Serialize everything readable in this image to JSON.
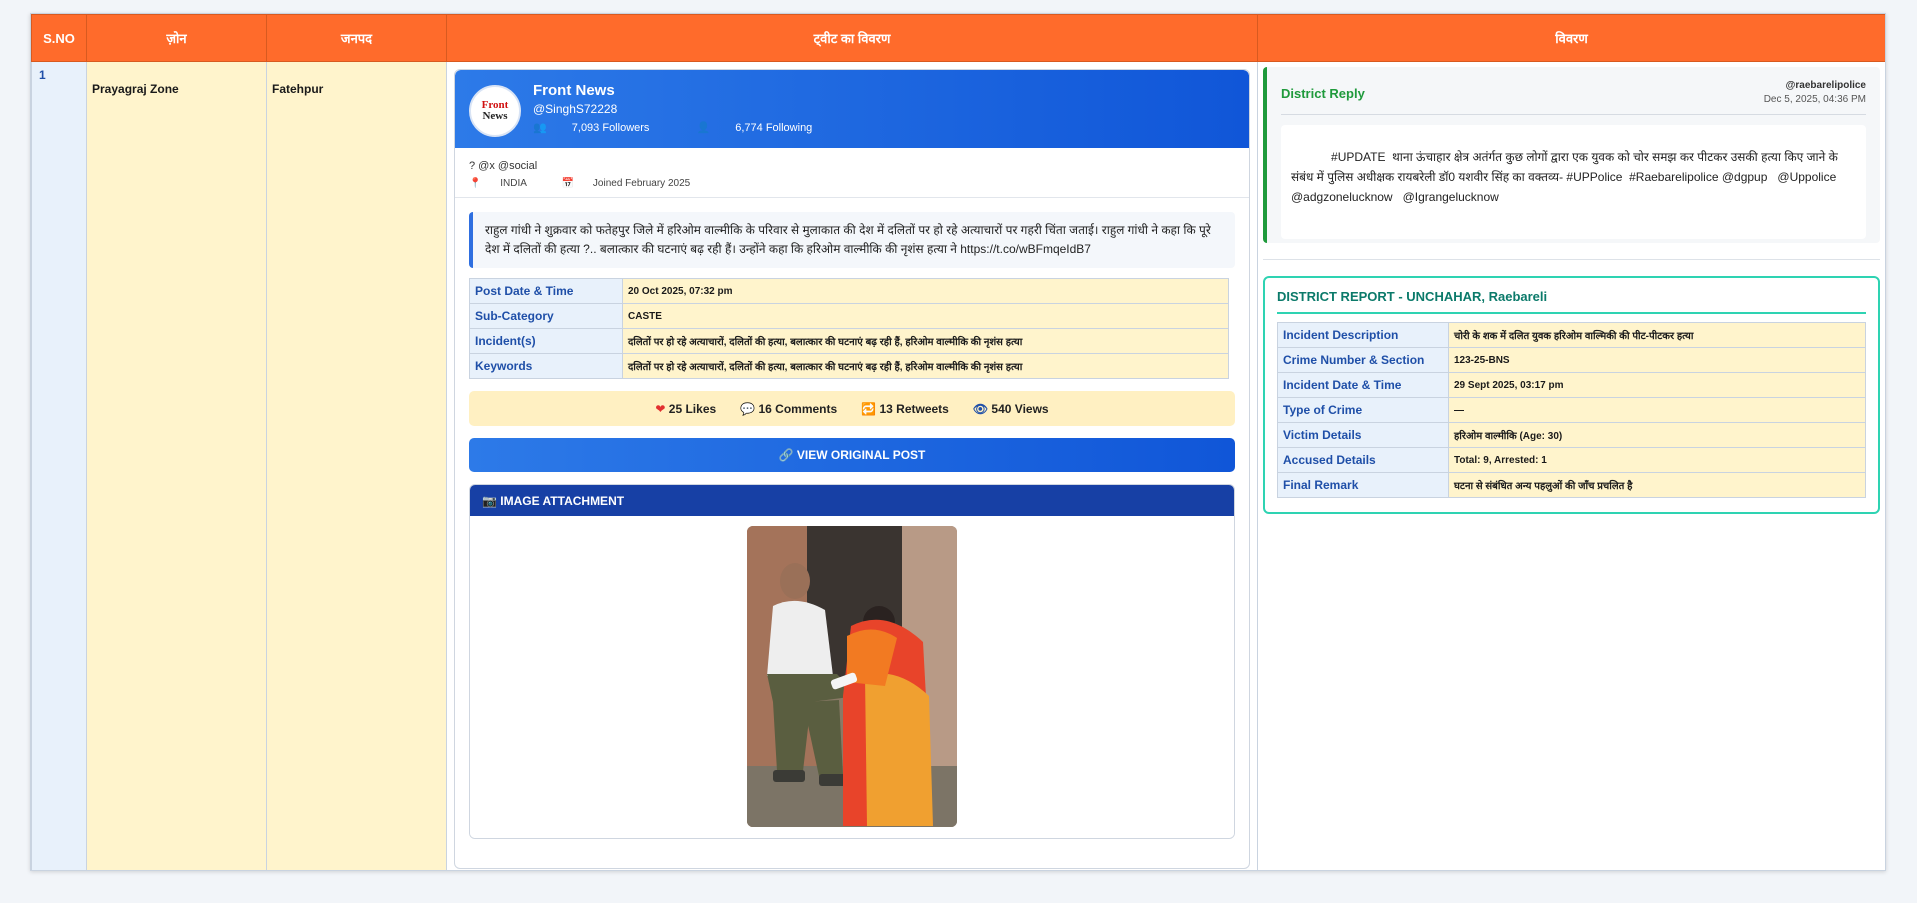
{
  "headers": {
    "sno": "S.NO",
    "zone": "ज़ोन",
    "district": "जनपद",
    "tweet": "ट्वीट का विवरण",
    "description": "विवरण"
  },
  "row": {
    "sno": "1",
    "zone": "Prayagraj Zone",
    "district": "Fatehpur"
  },
  "account": {
    "avatar_line1": "Front",
    "avatar_line2": "News",
    "name": "Front News",
    "handle": "@SinghS72228",
    "followers": "7,093 Followers",
    "following": "6,774 Following",
    "bio": "? @x @social",
    "location": "INDIA",
    "joined": "Joined February 2025"
  },
  "tweet": {
    "text": "राहुल गांधी ने शुक्रवार को फतेहपुर जिले में हरिओम वाल्मीकि के परिवार से मुलाकात की देश में दलितों पर हो रहे अत्याचारों पर गहरी चिंता जताई। राहुल गांधी ने कहा कि पूरे देश में दलितों की हत्या ?.. बलात्कार की घटनाएं बढ़ रही हैं। उन्होंने कहा कि हरिओम वाल्मीकि की नृशंस हत्या ने https://t.co/wBFmqeIdB7",
    "details": [
      {
        "label": "Post Date & Time",
        "value": "20 Oct 2025, 07:32 pm"
      },
      {
        "label": "Sub-Category",
        "value": "CASTE"
      },
      {
        "label": "Incident(s)",
        "value": "दलितों पर हो रहे अत्याचारों, दलितों की हत्या, बलात्कार की घटनाएं बढ़ रही हैं, हरिओम वाल्मीकि की नृशंस हत्या"
      },
      {
        "label": "Keywords",
        "value": "दलितों पर हो रहे अत्याचारों, दलितों की हत्या, बलात्कार की घटनाएं बढ़ रही हैं, हरिओम वाल्मीकि की नृशंस हत्या"
      }
    ],
    "likes": "25 Likes",
    "comments": "16 Comments",
    "retweets": "13 Retweets",
    "views": "540 Views",
    "view_button": "VIEW ORIGINAL POST",
    "attachment_title": "IMAGE ATTACHMENT"
  },
  "reply": {
    "title": "District Reply",
    "user": "@raebarelipolice",
    "time": "Dec 5, 2025, 04:36 PM",
    "text": "            #UPDATE  थाना ऊंचाहार क्षेत्र अतंर्गत कुछ लोगों द्वारा एक युवक को चोर समझ कर पीटकर उसकी हत्या किए जाने के संबंध में पुलिस अधीक्षक रायबरेली डॉ0 यशवीर सिंह का वक्तव्य- #UPPolice  #Raebarelipolice @dgpup   @Uppolice @adgzonelucknow   @Igrangelucknow"
  },
  "report": {
    "title": "DISTRICT REPORT - UNCHAHAR, Raebareli",
    "rows": [
      {
        "label": "Incident Description",
        "value": "चोरी के शक में दलित युवक हरिओम वाल्मिकी की पीट-पीटकर हत्या"
      },
      {
        "label": "Crime Number & Section",
        "value": "123-25-BNS"
      },
      {
        "label": "Incident Date & Time",
        "value": "29 Sept 2025, 03:17 pm"
      },
      {
        "label": "Type of Crime",
        "value": "—"
      },
      {
        "label": "Victim Details",
        "value": "हरिओम वाल्मीकि (Age: 30)"
      },
      {
        "label": "Accused Details",
        "value": "Total: 9, Arrested: 1"
      },
      {
        "label": "Final Remark",
        "value": "घटना से संबंधित अन्य पहलुओं की जाँच प्रचलित है"
      }
    ]
  },
  "colors": {
    "header_orange": "#ff6b2b",
    "tweet_blue": "#1056d8",
    "reply_green": "#1f9a3c",
    "report_teal": "#2ed3b2"
  }
}
